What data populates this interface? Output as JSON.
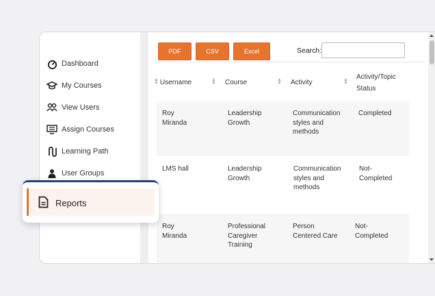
{
  "sidebar": {
    "items": [
      {
        "label": "Dashboard",
        "icon": "speedometer-icon"
      },
      {
        "label": "My Courses",
        "icon": "graduation-cap-icon"
      },
      {
        "label": "View Users",
        "icon": "users-icon"
      },
      {
        "label": "Assign Courses",
        "icon": "screen-list-icon"
      },
      {
        "label": "Learning Path",
        "icon": "path-icon"
      },
      {
        "label": "User Groups",
        "icon": "user-icon"
      }
    ],
    "active": {
      "label": "Reports",
      "icon": "document-icon"
    }
  },
  "toolbar": {
    "pdf_label": "PDF",
    "csv_label": "CSV",
    "excel_label": "Excel",
    "search_label": "Search:",
    "search_value": ""
  },
  "table": {
    "columns": [
      "Username",
      "Course",
      "Activity",
      "Activity/Topic",
      "Status"
    ],
    "rows": [
      {
        "username": [
          "Roy",
          "Miranda"
        ],
        "course": [
          "Leadership",
          "Growth"
        ],
        "activity": [
          "Communication",
          "styles and",
          "methods"
        ],
        "status": [
          "Completed"
        ]
      },
      {
        "username": [
          "LMS hall"
        ],
        "course": [
          "Leadership",
          "Growth"
        ],
        "activity": [
          "Communication",
          "styles and",
          "methods"
        ],
        "status": [
          "Not-",
          "Completed"
        ]
      },
      {
        "username": [
          "Roy",
          "Miranda"
        ],
        "course": [
          "Professional",
          "Caregiver",
          "Training"
        ],
        "activity": [
          "Person",
          "Centered Care"
        ],
        "status": [
          "Not-",
          "Completed"
        ]
      }
    ]
  },
  "colors": {
    "accent": "#e5742f",
    "navy": "#2b3f72"
  }
}
